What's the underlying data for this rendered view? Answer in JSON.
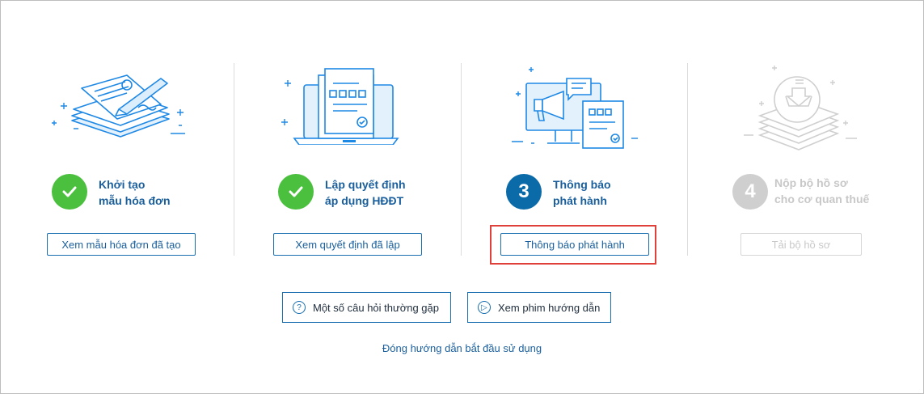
{
  "steps": [
    {
      "title_line1": "Khởi tạo",
      "title_line2": "mẫu hóa đơn",
      "status": "done",
      "button": "Xem mẫu hóa đơn đã tạo",
      "illustration": "document-pen-icon"
    },
    {
      "title_line1": "Lập quyết định",
      "title_line2": "áp dụng HĐĐT",
      "status": "done",
      "button": "Xem quyết định đã lập",
      "illustration": "laptop-document-icon"
    },
    {
      "number": "3",
      "title_line1": "Thông báo",
      "title_line2": "phát hành",
      "status": "current",
      "button": "Thông báo phát hành",
      "illustration": "monitor-megaphone-icon"
    },
    {
      "number": "4",
      "title_line1": "Nộp bộ hồ sơ",
      "title_line2": "cho cơ quan thuế",
      "status": "disabled",
      "button": "Tải bộ hồ sơ",
      "illustration": "stack-download-icon"
    }
  ],
  "help": {
    "faq_label": "Một số câu hỏi thường gặp",
    "faq_icon": "?",
    "video_label": "Xem phim hướng dẫn",
    "video_icon": "▷"
  },
  "close_link": "Đóng hướng dẫn bắt đầu sử dụng",
  "colors": {
    "accent": "#1a6fb0",
    "done": "#4bc03f",
    "current": "#0b6aa8",
    "disabled": "#cfcfcf",
    "highlight": "#e0403a"
  }
}
